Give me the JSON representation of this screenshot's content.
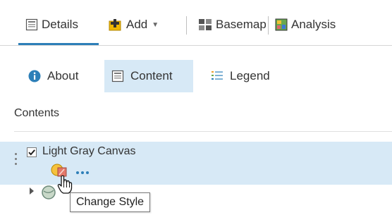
{
  "toolbar": {
    "details_label": "Details",
    "add_label": "Add",
    "basemap_label": "Basemap",
    "analysis_label": "Analysis"
  },
  "subtabs": {
    "about_label": "About",
    "content_label": "Content",
    "legend_label": "Legend",
    "active": "Content"
  },
  "contents": {
    "title": "Contents",
    "layers": [
      {
        "name": "Light Gray Canvas",
        "checked": true,
        "selected": true
      }
    ]
  },
  "tooltip": {
    "text": "Change Style"
  },
  "colors": {
    "accent": "#2d7fb8",
    "selected_bg": "#d7e9f6",
    "info_icon": "#2d7fb8",
    "add_icon": "#f0b800"
  },
  "icons": [
    "details-icon",
    "add-icon",
    "caret-down-icon",
    "basemap-icon",
    "analysis-icon",
    "info-icon",
    "content-icon",
    "legend-icon",
    "drag-handle-icon",
    "checkbox-icon",
    "change-style-icon",
    "more-options-icon",
    "expand-caret-icon",
    "layer-icon",
    "hand-cursor-icon"
  ]
}
